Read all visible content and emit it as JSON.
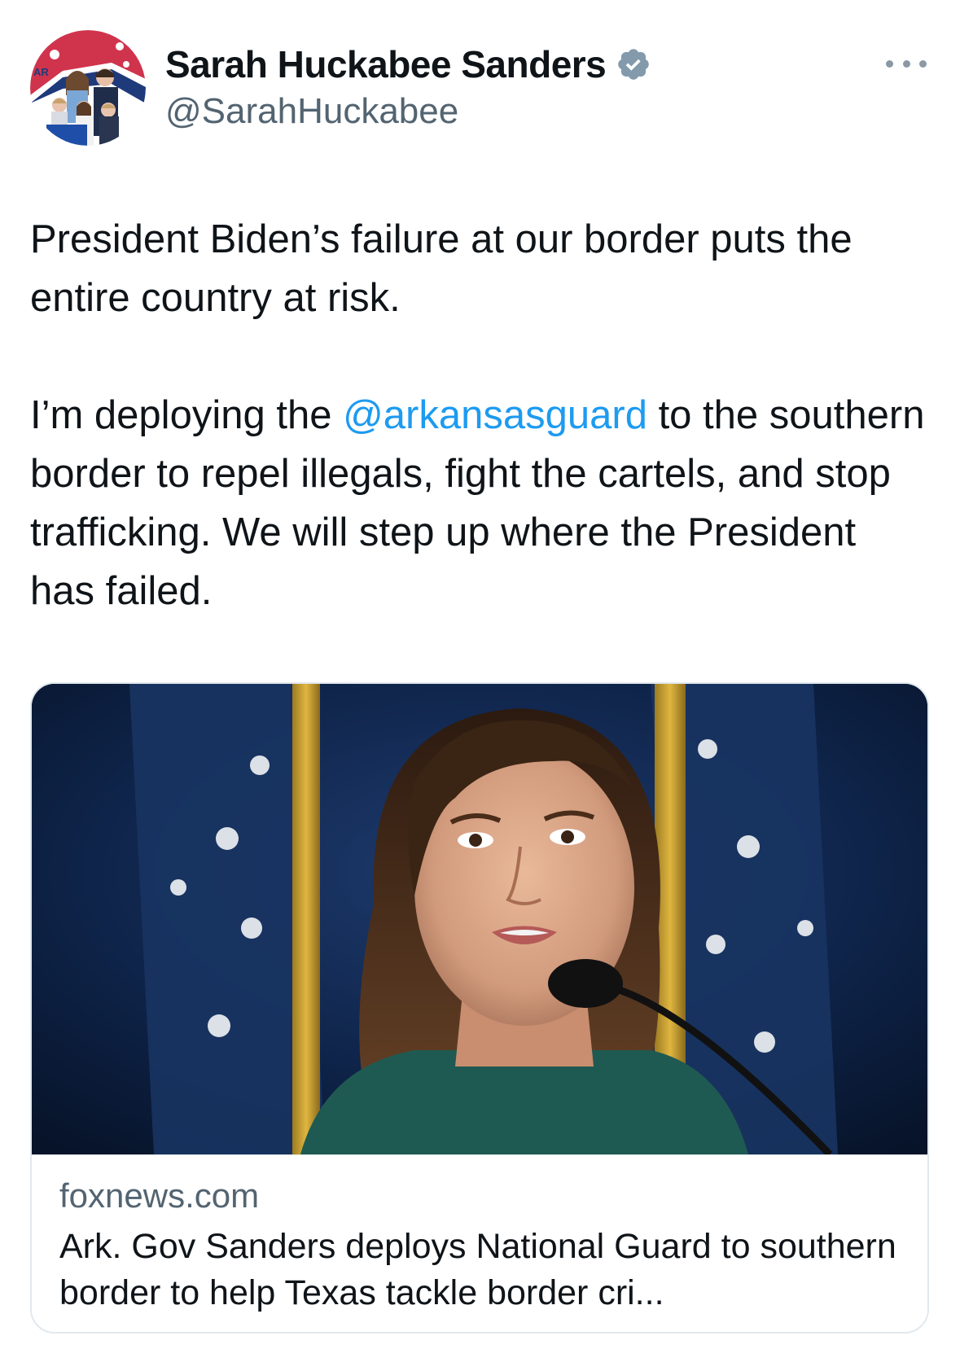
{
  "author": {
    "display_name": "Sarah Huckabee Sanders",
    "handle": "@SarahHuckabee",
    "verified": true,
    "avatar_icon": "profile-photo",
    "avatar_text": "AR"
  },
  "tweet": {
    "paragraph1": "President Biden’s failure at our border puts the entire country at risk.",
    "paragraph2_before": "I’m deploying the ",
    "mention": "@arkansasguard",
    "paragraph2_after": " to the southern border to repel illegals, fight the cartels, and stop trafficking. We will step up where the President has failed."
  },
  "link_card": {
    "domain": "foxnews.com",
    "title": "Ark. Gov Sanders deploys National Guard to southern border to help Texas tackle border cri..."
  },
  "colors": {
    "link": "#1d9bf0",
    "secondary_text": "#536471",
    "verified_badge": "#829aab"
  }
}
